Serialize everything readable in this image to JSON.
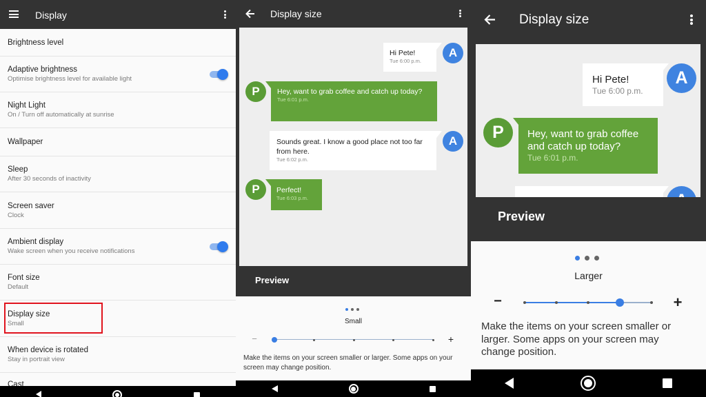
{
  "panel1": {
    "title": "Display",
    "rows": [
      {
        "label": "Brightness level",
        "sub": ""
      },
      {
        "label": "Adaptive brightness",
        "sub": "Optimise brightness level for available light",
        "toggle": true
      },
      {
        "label": "Night Light",
        "sub": "On / Turn off automatically at sunrise"
      },
      {
        "label": "Wallpaper",
        "sub": ""
      },
      {
        "label": "Sleep",
        "sub": "After 30 seconds of inactivity"
      },
      {
        "label": "Screen saver",
        "sub": "Clock"
      },
      {
        "label": "Ambient display",
        "sub": "Wake screen when you receive notifications",
        "toggle": true
      },
      {
        "label": "Font size",
        "sub": "Default"
      },
      {
        "label": "Display size",
        "sub": "Small"
      },
      {
        "label": "When device is rotated",
        "sub": "Stay in portrait view"
      },
      {
        "label": "Cast",
        "sub": ""
      }
    ]
  },
  "panel2": {
    "title": "Display size",
    "messages": [
      {
        "text": "Hi Pete!",
        "time": "Tue 6:00 p.m.",
        "from": "A"
      },
      {
        "text": "Hey, want to grab coffee and catch up today?",
        "time": "Tue 6:01 p.m.",
        "from": "P"
      },
      {
        "text": "Sounds great. I know a good place not too far from here.",
        "time": "Tue 6:02 p.m.",
        "from": "A"
      },
      {
        "text": "Perfect!",
        "time": "Tue 6:03 p.m.",
        "from": "P"
      }
    ],
    "preview_label": "Preview",
    "size_label": "Small",
    "minus": "−",
    "plus": "+",
    "description": "Make the items on your screen smaller or larger. Some apps on your screen may change position.",
    "slider_level": 0,
    "slider_steps": 5
  },
  "panel3": {
    "title": "Display size",
    "messages": [
      {
        "text": "Hi Pete!",
        "time": "Tue 6:00 p.m.",
        "from": "A"
      },
      {
        "text": "Hey, want to grab coffee and catch up today?",
        "time": "Tue 6:01 p.m.",
        "from": "P"
      }
    ],
    "preview_label": "Preview",
    "size_label": "Larger",
    "minus": "−",
    "plus": "+",
    "description": "Make the items on your screen smaller or larger. Some apps on your screen may change position.",
    "slider_level": 3,
    "slider_steps": 5
  },
  "colors": {
    "toolbar": "#333333",
    "accent": "#3a7ee3",
    "bubble_green": "#63a33a",
    "avatar_blue": "#3f83e0",
    "avatar_green": "#5a9c36",
    "highlight": "#e0131d"
  },
  "icons": {
    "menu": "hamburger-icon",
    "back": "arrow-back-icon",
    "more": "more-vert-icon",
    "nav_back": "triangle-back-icon",
    "nav_home": "circle-home-icon",
    "nav_recent": "square-recent-icon"
  }
}
